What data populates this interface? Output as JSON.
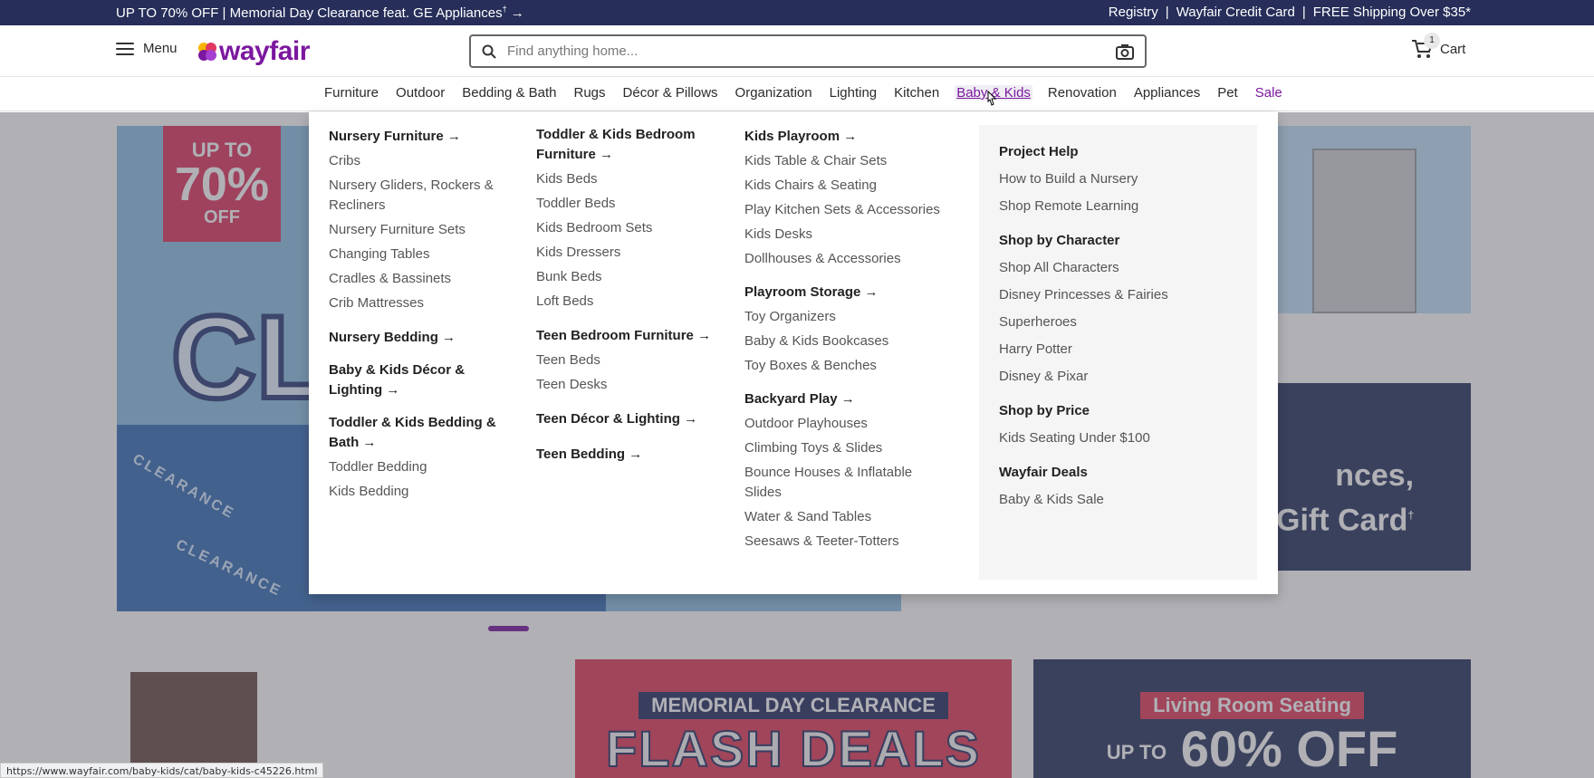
{
  "promo": {
    "left_text": "UP TO 70% OFF | Memorial Day Clearance feat. GE Appliances",
    "left_mark": "†",
    "right_links": [
      "Registry",
      "Wayfair Credit Card",
      "FREE Shipping Over $35*"
    ]
  },
  "header": {
    "menu_label": "Menu",
    "logo_text": "wayfair",
    "search_placeholder": "Find anything home...",
    "cart_label": "Cart",
    "cart_count": "1"
  },
  "nav": {
    "items": [
      "Furniture",
      "Outdoor",
      "Bedding & Bath",
      "Rugs",
      "Décor & Pillows",
      "Organization",
      "Lighting",
      "Kitchen",
      "Baby & Kids",
      "Renovation",
      "Appliances",
      "Pet",
      "Sale"
    ],
    "active": "Baby & Kids"
  },
  "mega_menu": {
    "col1": [
      {
        "heading": "Nursery Furniture",
        "items": [
          "Cribs",
          "Nursery Gliders, Rockers & Recliners",
          "Nursery Furniture Sets",
          "Changing Tables",
          "Cradles & Bassinets",
          "Crib Mattresses"
        ]
      },
      {
        "heading": "Nursery Bedding",
        "items": []
      },
      {
        "heading": "Baby & Kids Décor & Lighting",
        "items": []
      },
      {
        "heading": "Toddler & Kids Bedding & Bath",
        "items": [
          "Toddler Bedding",
          "Kids Bedding"
        ]
      }
    ],
    "col2": [
      {
        "heading": "Toddler & Kids Bedroom Furniture",
        "items": [
          "Kids Beds",
          "Toddler Beds",
          "Kids Bedroom Sets",
          "Kids Dressers",
          "Bunk Beds",
          "Loft Beds"
        ]
      },
      {
        "heading": "Teen Bedroom Furniture",
        "items": [
          "Teen Beds",
          "Teen Desks"
        ]
      },
      {
        "heading": "Teen Décor & Lighting",
        "items": []
      },
      {
        "heading": "Teen Bedding",
        "items": []
      }
    ],
    "col3": [
      {
        "heading": "Kids Playroom",
        "items": [
          "Kids Table & Chair Sets",
          "Kids Chairs & Seating",
          "Play Kitchen Sets & Accessories",
          "Kids Desks",
          "Dollhouses & Accessories"
        ]
      },
      {
        "heading": "Playroom Storage",
        "items": [
          "Toy Organizers",
          "Baby & Kids Bookcases",
          "Toy Boxes & Benches"
        ]
      },
      {
        "heading": "Backyard Play",
        "items": [
          "Outdoor Playhouses",
          "Climbing Toys & Slides",
          "Bounce Houses & Inflatable Slides",
          "Water & Sand Tables",
          "Seesaws & Teeter-Totters"
        ]
      }
    ],
    "help": [
      {
        "heading": "Project Help",
        "items": [
          "How to Build a Nursery",
          "Shop Remote Learning"
        ]
      },
      {
        "heading": "Shop by Character",
        "items": [
          "Shop All Characters",
          "Disney Princesses & Fairies",
          "Superheroes",
          "Harry Potter",
          "Disney & Pixar"
        ]
      },
      {
        "heading": "Shop by Price",
        "items": [
          "Kids Seating Under $100"
        ]
      },
      {
        "heading": "Wayfair Deals",
        "items": [
          "Baby & Kids Sale"
        ]
      }
    ]
  },
  "background": {
    "hero_tag": [
      "UP TO",
      "70%",
      "OFF"
    ],
    "hero_big": "CL",
    "hero_wave_word": "CLEARANCE",
    "dark_card_text": [
      "nces,",
      "Gift Card"
    ],
    "dark_card_mark": "†",
    "flash_top": "MEMORIAL DAY CLEARANCE",
    "flash_main": "FLASH DEALS",
    "living_top": "Living Room Seating",
    "living_up_to": "UP TO",
    "living_main": "60% OFF"
  },
  "status_url": "https://www.wayfair.com/baby-kids/cat/baby-kids-c45226.html",
  "colors": {
    "brand": "#7b189f",
    "promo_bg": "#262e59"
  }
}
